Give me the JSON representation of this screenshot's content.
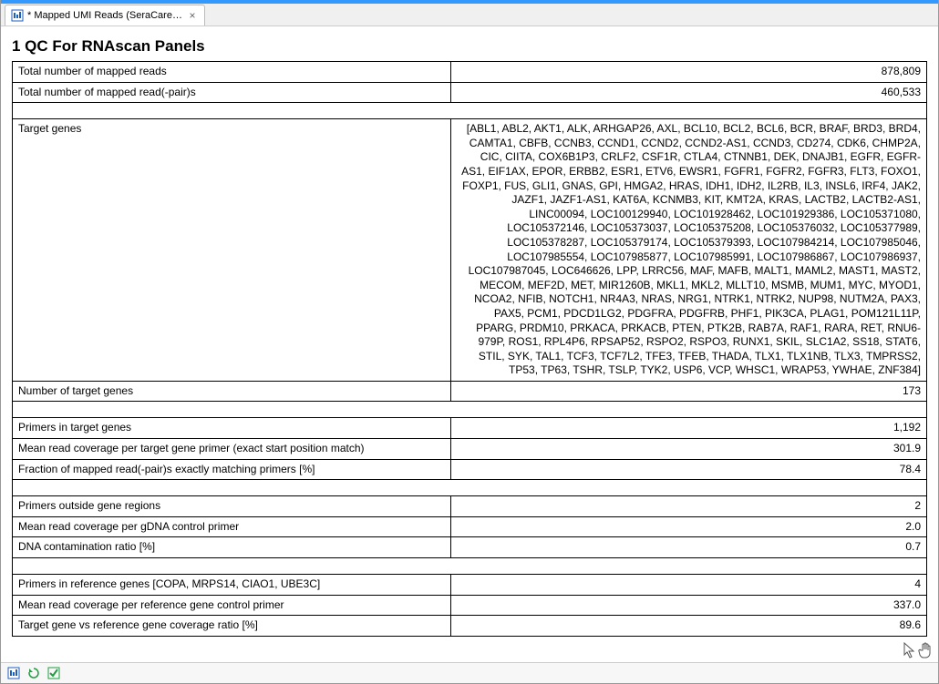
{
  "tab": {
    "label": "* Mapped UMI Reads (SeraCareTFR...",
    "close": "×"
  },
  "title": "1 QC For RNAscan Panels",
  "rows": {
    "total_mapped_reads_label": "Total number of mapped reads",
    "total_mapped_reads_value": "878,809",
    "total_mapped_read_pairs_label": "Total number of mapped read(-pair)s",
    "total_mapped_read_pairs_value": "460,533",
    "target_genes_label": "Target genes",
    "target_genes_value": "[ABL1, ABL2, AKT1, ALK, ARHGAP26, AXL, BCL10, BCL2, BCL6, BCR, BRAF, BRD3, BRD4, CAMTA1, CBFB, CCNB3, CCND1, CCND2, CCND2-AS1, CCND3, CD274, CDK6, CHMP2A, CIC, CIITA, COX6B1P3, CRLF2, CSF1R, CTLA4, CTNNB1, DEK, DNAJB1, EGFR, EGFR-AS1, EIF1AX, EPOR, ERBB2, ESR1, ETV6, EWSR1, FGFR1, FGFR2, FGFR3, FLT3, FOXO1, FOXP1, FUS, GLI1, GNAS, GPI, HMGA2, HRAS, IDH1, IDH2, IL2RB, IL3, INSL6, IRF4, JAK2, JAZF1, JAZF1-AS1, KAT6A, KCNMB3, KIT, KMT2A, KRAS, LACTB2, LACTB2-AS1, LINC00094, LOC100129940, LOC101928462, LOC101929386, LOC105371080, LOC105372146, LOC105373037, LOC105375208, LOC105376032, LOC105377989, LOC105378287, LOC105379174, LOC105379393, LOC107984214, LOC107985046, LOC107985554, LOC107985877, LOC107985991, LOC107986867, LOC107986937, LOC107987045, LOC646626, LPP, LRRC56, MAF, MAFB, MALT1, MAML2, MAST1, MAST2, MECOM, MEF2D, MET, MIR1260B, MKL1, MKL2, MLLT10, MSMB, MUM1, MYC, MYOD1, NCOA2, NFIB, NOTCH1, NR4A3, NRAS, NRG1, NTRK1, NTRK2, NUP98, NUTM2A, PAX3, PAX5, PCM1, PDCD1LG2, PDGFRA, PDGFRB, PHF1, PIK3CA, PLAG1, POM121L11P, PPARG, PRDM10, PRKACA, PRKACB, PTEN, PTK2B, RAB7A, RAF1, RARA, RET, RNU6-979P, ROS1, RPL4P6, RPSAP52, RSPO2, RSPO3, RUNX1, SKIL, SLC1A2, SS18, STAT6, STIL, SYK, TAL1, TCF3, TCF7L2, TFE3, TFEB, THADA, TLX1, TLX1NB, TLX3, TMPRSS2, TP53, TP63, TSHR, TSLP, TYK2, USP6, VCP, WHSC1, WRAP53, YWHAE, ZNF384]",
    "num_target_genes_label": "Number of target genes",
    "num_target_genes_value": "173",
    "primers_in_target_label": "Primers in target genes",
    "primers_in_target_value": "1,192",
    "mean_read_cov_target_label": "Mean read coverage per target gene primer (exact start position match)",
    "mean_read_cov_target_value": "301.9",
    "fraction_matching_label": "Fraction of mapped read(-pair)s exactly matching primers [%]",
    "fraction_matching_value": "78.4",
    "primers_outside_label": "Primers outside gene regions",
    "primers_outside_value": "2",
    "mean_read_cov_gdna_label": "Mean read coverage per gDNA control primer",
    "mean_read_cov_gdna_value": "2.0",
    "dna_contam_label": "DNA contamination ratio [%]",
    "dna_contam_value": "0.7",
    "primers_ref_label": "Primers in reference genes [COPA, MRPS14, CIAO1, UBE3C]",
    "primers_ref_value": "4",
    "mean_read_cov_ref_label": "Mean read coverage per reference gene control primer",
    "mean_read_cov_ref_value": "337.0",
    "target_vs_ref_label": "Target gene vs reference gene coverage ratio [%]",
    "target_vs_ref_value": "89.6"
  }
}
